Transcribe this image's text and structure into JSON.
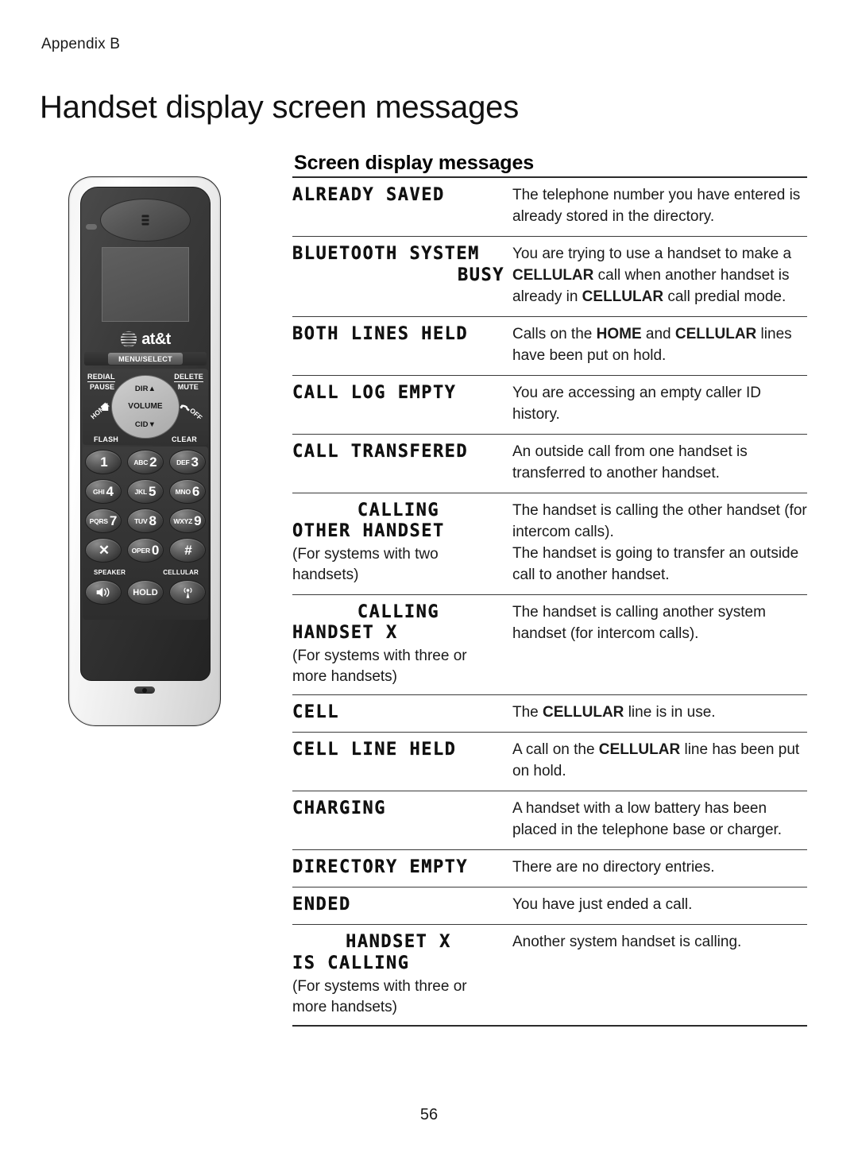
{
  "header": {
    "appendix": "Appendix B",
    "title": "Handset display screen messages",
    "section_heading": "Screen display messages"
  },
  "handset": {
    "brand": "at&t",
    "menu_select": "MENU/SELECT",
    "nav": {
      "up": "DIR▲",
      "center": "VOLUME",
      "down": "CID▼"
    },
    "labels": {
      "redial": "REDIAL",
      "pause": "PAUSE",
      "delete": "DELETE",
      "mute": "MUTE",
      "home": "HOME",
      "flash": "FLASH",
      "off": "OFF",
      "clear": "CLEAR",
      "speaker": "SPEAKER",
      "cellular": "CELLULAR",
      "hold": "HOLD"
    },
    "keypad": [
      [
        {
          "alpha": "",
          "digit": "1"
        },
        {
          "alpha": "ABC",
          "digit": "2"
        },
        {
          "alpha": "DEF",
          "digit": "3"
        }
      ],
      [
        {
          "alpha": "GHI",
          "digit": "4"
        },
        {
          "alpha": "JKL",
          "digit": "5"
        },
        {
          "alpha": "MNO",
          "digit": "6"
        }
      ],
      [
        {
          "alpha": "PQRS",
          "digit": "7"
        },
        {
          "alpha": "TUV",
          "digit": "8"
        },
        {
          "alpha": "WXYZ",
          "digit": "9"
        }
      ],
      [
        {
          "alpha": "",
          "digit": "✕"
        },
        {
          "alpha": "OPER",
          "digit": "0"
        },
        {
          "alpha": "",
          "digit": "#"
        }
      ]
    ]
  },
  "table": {
    "rows": [
      {
        "message_lines": [
          "ALREADY SAVED"
        ],
        "align": "left",
        "note": "",
        "desc_html": "The telephone number you have entered is already stored in the directory."
      },
      {
        "message_lines": [
          "BLUETOOTH SYSTEM",
          "BUSY"
        ],
        "align": "right",
        "note": "",
        "desc_html": "You are trying to use a handset to make a <b>CELLULAR</b> call when another handset is already in <b>CELLULAR</b> call predial mode."
      },
      {
        "message_lines": [
          "BOTH LINES HELD"
        ],
        "align": "left",
        "note": "",
        "desc_html": "Calls on the <b>HOME</b> and <b>CELLULAR</b> lines have been put on hold."
      },
      {
        "message_lines": [
          "CALL LOG EMPTY"
        ],
        "align": "left",
        "note": "",
        "desc_html": "You are accessing an empty caller ID history."
      },
      {
        "message_lines": [
          "CALL TRANSFERED"
        ],
        "align": "left",
        "note": "",
        "desc_html": "An outside call from one handset is transferred to another handset."
      },
      {
        "message_lines": [
          "CALLING",
          "OTHER HANDSET"
        ],
        "align": "center",
        "note": "(For systems with two handsets)",
        "desc_html": "The handset is calling the other handset (for intercom calls).<br>The handset is going to transfer an outside call to another handset."
      },
      {
        "message_lines": [
          "CALLING",
          "HANDSET X"
        ],
        "align": "center",
        "note": "(For systems with three or more handsets)",
        "desc_html": "The handset is calling another system handset (for intercom calls)."
      },
      {
        "message_lines": [
          "CELL"
        ],
        "align": "left",
        "note": "",
        "desc_html": "The <b>CELLULAR</b> line is in use."
      },
      {
        "message_lines": [
          "CELL LINE HELD"
        ],
        "align": "left",
        "note": "",
        "desc_html": "A call on the <b>CELLULAR</b> line has been put on hold."
      },
      {
        "message_lines": [
          "CHARGING"
        ],
        "align": "left",
        "note": "",
        "desc_html": "A handset with a low battery has been placed in the telephone base or charger."
      },
      {
        "message_lines": [
          "DIRECTORY EMPTY"
        ],
        "align": "left",
        "note": "",
        "desc_html": "There are no directory entries."
      },
      {
        "message_lines": [
          "ENDED"
        ],
        "align": "left",
        "note": "",
        "desc_html": "You have just ended a call."
      },
      {
        "message_lines": [
          "HANDSET X",
          "IS CALLING"
        ],
        "align": "center",
        "note": "(For systems with three or more handsets)",
        "desc_html": "Another system handset is calling."
      }
    ]
  },
  "footer": {
    "page_number": "56"
  }
}
